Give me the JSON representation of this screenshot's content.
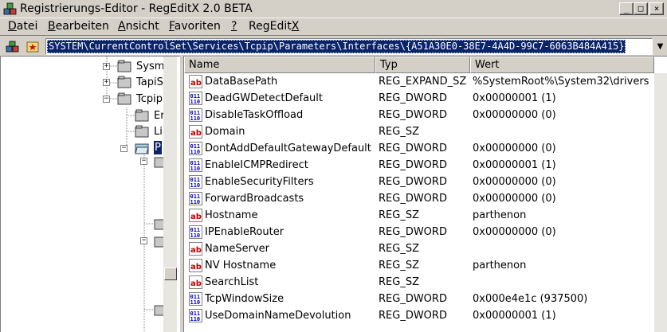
{
  "window": {
    "title": "Registrierungs-Editor - RegEditX 2.0 BETA",
    "minimize_glyph": "_",
    "maximize_glyph": "□",
    "close_glyph": "×",
    "app_icon": "registry-cubes-icon"
  },
  "menu": [
    {
      "label": "Datei",
      "mnemonic": "D"
    },
    {
      "label": "Bearbeiten",
      "mnemonic": "B"
    },
    {
      "label": "Ansicht",
      "mnemonic": "A"
    },
    {
      "label": "Favoriten",
      "mnemonic": "F"
    },
    {
      "label": "?",
      "mnemonic": "?"
    },
    {
      "label": "RegEditX",
      "mnemonic": "X"
    }
  ],
  "address": {
    "value": "SYSTEM\\CurrentControlSet\\Services\\Tcpip\\Parameters\\Interfaces\\{A51A30E0-38E7-4A4D-99C7-6063B484A415}",
    "dropdown_glyph": "▼"
  },
  "tree": {
    "items": [
      {
        "label": "Sysm",
        "expander": "+"
      },
      {
        "label": "TapiS",
        "expander": "+"
      },
      {
        "label": "Tcpip",
        "expander": "−"
      },
      {
        "label": "Er",
        "expander": ""
      },
      {
        "label": "Li",
        "expander": ""
      },
      {
        "label": "P",
        "expander": "−",
        "selected": true
      }
    ]
  },
  "list": {
    "columns": {
      "name": "Name",
      "type": "Typ",
      "value": "Wert"
    },
    "rows": [
      {
        "name": "DataBasePath",
        "type": "REG_EXPAND_SZ",
        "value": "%SystemRoot%\\System32\\drivers",
        "kind": "string"
      },
      {
        "name": "DeadGWDetectDefault",
        "type": "REG_DWORD",
        "value": "0x00000001 (1)",
        "kind": "binary"
      },
      {
        "name": "DisableTaskOffload",
        "type": "REG_DWORD",
        "value": "0x00000000 (0)",
        "kind": "binary"
      },
      {
        "name": "Domain",
        "type": "REG_SZ",
        "value": "",
        "kind": "string"
      },
      {
        "name": "DontAddDefaultGatewayDefault",
        "type": "REG_DWORD",
        "value": "0x00000000 (0)",
        "kind": "binary"
      },
      {
        "name": "EnableICMPRedirect",
        "type": "REG_DWORD",
        "value": "0x00000001 (1)",
        "kind": "binary"
      },
      {
        "name": "EnableSecurityFilters",
        "type": "REG_DWORD",
        "value": "0x00000000 (0)",
        "kind": "binary"
      },
      {
        "name": "ForwardBroadcasts",
        "type": "REG_DWORD",
        "value": "0x00000000 (0)",
        "kind": "binary"
      },
      {
        "name": "Hostname",
        "type": "REG_SZ",
        "value": "parthenon",
        "kind": "string"
      },
      {
        "name": "IPEnableRouter",
        "type": "REG_DWORD",
        "value": "0x00000000 (0)",
        "kind": "binary"
      },
      {
        "name": "NameServer",
        "type": "REG_SZ",
        "value": "",
        "kind": "string"
      },
      {
        "name": "NV Hostname",
        "type": "REG_SZ",
        "value": "parthenon",
        "kind": "string"
      },
      {
        "name": "SearchList",
        "type": "REG_SZ",
        "value": "",
        "kind": "string"
      },
      {
        "name": "TcpWindowSize",
        "type": "REG_DWORD",
        "value": "0x000e4e1c (937500)",
        "kind": "binary"
      },
      {
        "name": "UseDomainNameDevolution",
        "type": "REG_DWORD",
        "value": "0x00000001 (1)",
        "kind": "binary"
      }
    ]
  },
  "colors": {
    "selection": "#0a246a",
    "chrome": "#d4d0c8",
    "string_icon_red": "#c00000",
    "binary_icon_blue": "#0000c0"
  }
}
